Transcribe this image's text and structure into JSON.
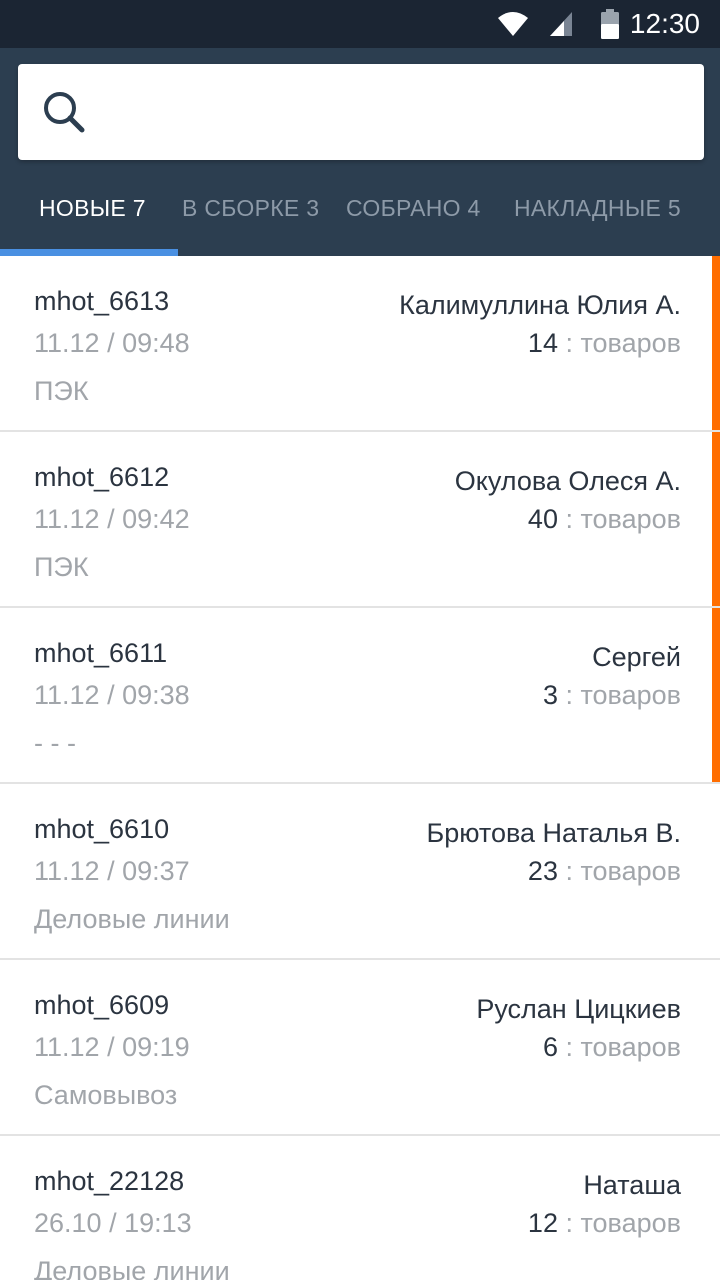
{
  "status_bar": {
    "time": "12:30",
    "icons": [
      "wifi-icon",
      "signal-icon",
      "battery-icon"
    ]
  },
  "search": {
    "placeholder": "",
    "icon": "search-icon"
  },
  "tabs": [
    {
      "label": "НОВЫЕ 7",
      "active": true
    },
    {
      "label": "В СБОРКЕ 3",
      "active": false
    },
    {
      "label": "СОБРАНО 4",
      "active": false
    },
    {
      "label": "НАКЛАДНЫЕ 5",
      "active": false
    }
  ],
  "orders": [
    {
      "id": "mhot_6613",
      "date": "11.12  /  09:48",
      "carrier": "ПЭК",
      "customer": "Калимуллина Юлия А.",
      "count": "14",
      "unit": " : товаров"
    },
    {
      "id": "mhot_6612",
      "date": "11.12  /  09:42",
      "carrier": "ПЭК",
      "customer": "Окулова Олеся А.",
      "count": "40",
      "unit": " : товаров"
    },
    {
      "id": "mhot_6611",
      "date": "11.12  /  09:38",
      "carrier": "- - -",
      "customer": "Сергей",
      "count": "3",
      "unit": " : товаров"
    },
    {
      "id": "mhot_6610",
      "date": "11.12  /  09:37",
      "carrier": "Деловые линии",
      "customer": "Брютова Наталья В.",
      "count": "23",
      "unit": " : товаров"
    },
    {
      "id": "mhot_6609",
      "date": "11.12  /  09:19",
      "carrier": "Самовывоз",
      "customer": "Руслан Цицкиев",
      "count": "6",
      "unit": " : товаров"
    },
    {
      "id": "mhot_22128",
      "date": "26.10  /  19:13",
      "carrier": "Деловые линии",
      "customer": "Наташа",
      "count": "12",
      "unit": " : товаров"
    }
  ],
  "colors": {
    "appbar": "#2c3e50",
    "statusbar": "#1b2533",
    "tab_indicator": "#4a90e2",
    "accent_bar": "#ff6d00"
  }
}
